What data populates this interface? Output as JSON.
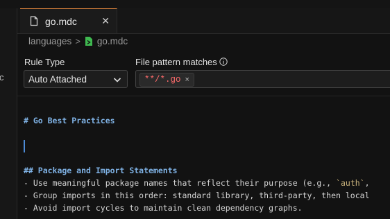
{
  "left_panel": {
    "cut_text": "c"
  },
  "tab": {
    "label": "go.mdc",
    "file_icon": "file-icon",
    "close_icon": "close-icon"
  },
  "breadcrumb": {
    "folder": "languages",
    "separator": ">",
    "file": "go.mdc"
  },
  "rule_type": {
    "label": "Rule Type",
    "value": "Auto Attached"
  },
  "file_pattern": {
    "label": "File pattern matches",
    "chips": [
      "**/*.go"
    ],
    "remove_icon": "×"
  },
  "editor": {
    "heading1": "# Go Best Practices",
    "heading2": "## Package and Import Statements",
    "bullet1_pre": "- Use meaningful package names that reflect their purpose (e.g., ",
    "bullet1_code": "`auth`",
    "bullet1_post": ",",
    "bullet2": "- Group imports in this order: standard library, third-party, then local",
    "bullet3": "- Avoid import cycles to maintain clean dependency graphs."
  },
  "colors": {
    "accent": "#d9823b",
    "heading": "#7fb2e5",
    "pattern": "#ff6b6b",
    "cursor": "#4d8bd6",
    "mdc_icon": "#3fb950"
  }
}
